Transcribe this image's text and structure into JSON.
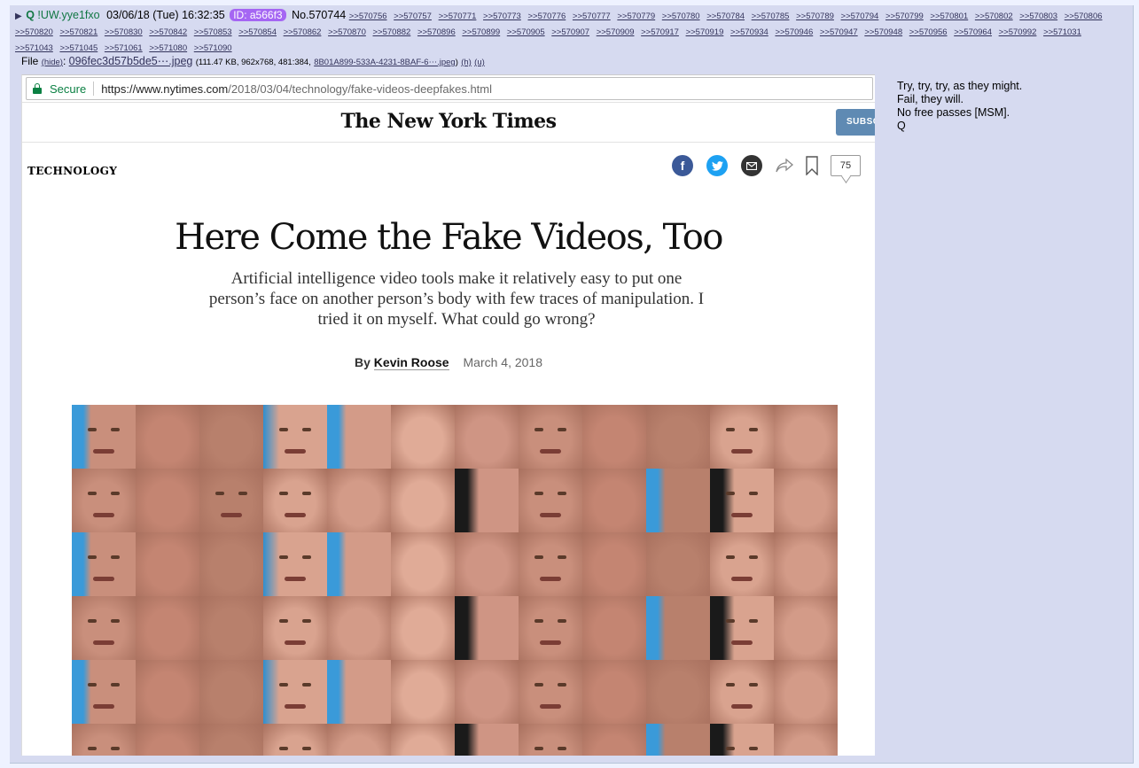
{
  "post": {
    "caret": "▶",
    "name": "Q",
    "tripcode": "!UW.yye1fxo",
    "datetime": "03/06/18 (Tue) 16:32:35",
    "id": "ID: a566f3",
    "number": "No.570744",
    "backlinks": [
      ">>570756",
      ">>570757",
      ">>570771",
      ">>570773",
      ">>570776",
      ">>570777",
      ">>570779",
      ">>570780",
      ">>570784",
      ">>570785",
      ">>570789",
      ">>570794",
      ">>570799",
      ">>570801",
      ">>570802",
      ">>570803",
      ">>570806",
      ">>570820",
      ">>570821",
      ">>570830",
      ">>570842",
      ">>570853",
      ">>570854",
      ">>570862",
      ">>570870",
      ">>570882",
      ">>570896",
      ">>570899",
      ">>570905",
      ">>570907",
      ">>570909",
      ">>570917",
      ">>570919",
      ">>570934",
      ">>570946",
      ">>570947",
      ">>570948",
      ">>570956",
      ">>570964",
      ">>570992",
      ">>571031",
      ">>571043",
      ">>571045",
      ">>571061",
      ">>571080",
      ">>571090"
    ],
    "file": {
      "label": "File",
      "hide": "(hide)",
      "filename": "096fec3d57b5de5⋯.jpeg",
      "meta_open": "(111.47 KB, 962x768, 481:384,",
      "orig_name": "8B01A899-533A-4231-8BAF-6⋯.jpeg",
      "meta_close": ")",
      "h": "(h)",
      "u": "(u)"
    },
    "comment_lines": [
      "Try, try, try, as they might.",
      "Fail, they will.",
      "No free passes [MSM].",
      "Q"
    ]
  },
  "screenshot": {
    "secure_label": "Secure",
    "url_host": "https://www.nytimes.com",
    "url_path": "/2018/03/04/technology/fake-videos-deepfakes.html",
    "masthead": "The New York Times",
    "subscribe": "SUBSC",
    "section": "TECHNOLOGY",
    "comment_count": "75",
    "headline": "Here Come the Fake Videos, Too",
    "summary": "Artificial intelligence video tools make it relatively easy to put one person’s face on another person’s body with few traces of manipulation. I tried it on myself. What could go wrong?",
    "byline_by": "By",
    "author": "Kevin Roose",
    "date": "March 4, 2018"
  },
  "colors": {
    "post_bg": "#d6daf0",
    "page_bg": "#eef2ff",
    "name_green": "#117743",
    "id_purple": "#a566f3",
    "link": "#34345c",
    "secure_green": "#0b8043",
    "facebook": "#3b5998",
    "twitter": "#1da1f2",
    "subscribe_blue": "#5f8ab3"
  },
  "icons": [
    "facebook-icon",
    "twitter-icon",
    "email-icon",
    "share-icon",
    "bookmark-icon",
    "comments-icon",
    "lock-icon"
  ],
  "face_grid": {
    "rows": 6,
    "cols": 12,
    "sharp_cells": [
      0,
      3,
      7,
      10,
      12,
      14,
      15,
      19,
      22,
      24,
      27,
      31,
      34,
      36,
      39,
      43,
      46,
      48,
      51,
      55,
      58,
      60,
      63,
      67,
      70
    ]
  }
}
